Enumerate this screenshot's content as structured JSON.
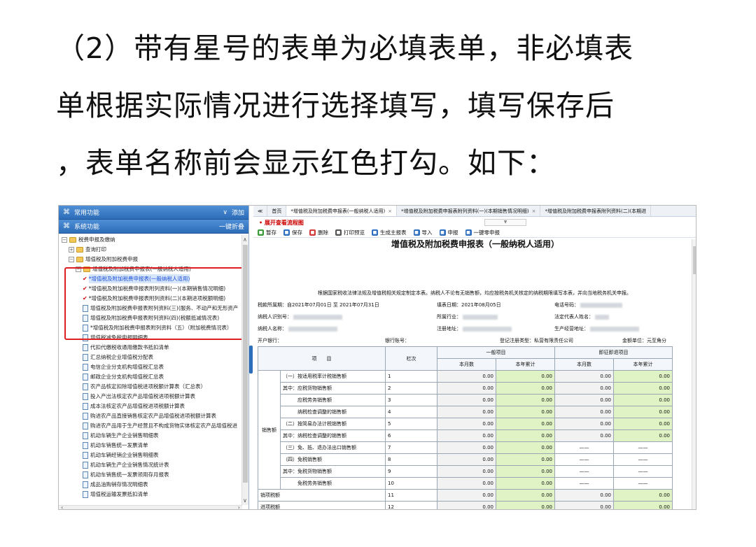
{
  "caption_lines": [
    "（2）带有星号的表单为必填表单，非必填表",
    "单根据实际情况进行选择填写，填写保存后",
    "，表单名称前会显示红色打勾。如下："
  ],
  "left": {
    "header1": {
      "icon": "grid-icon",
      "title": "常用功能",
      "chev": "∨",
      "action": "添加"
    },
    "header2": {
      "icon": "grid-icon",
      "title": "系统功能",
      "action": "一键折叠"
    },
    "tree": [
      {
        "text": "税费申报及缴纳",
        "toggle": "−",
        "folder": true,
        "indent": 0
      },
      {
        "text": "查询打印",
        "toggle": "+",
        "folder": true,
        "indent": 1
      },
      {
        "text": "增值税及附加税费申报",
        "toggle": "−",
        "folder": true,
        "indent": 1
      },
      {
        "text": "增值税及附加税费申报表(一般纳税人适用)",
        "toggle": "−",
        "folder": true,
        "indent": 2
      },
      {
        "text": "*增值税及附加税费申报表(一般纳税人适用)",
        "check": "✔",
        "indent": 3,
        "selected": true
      },
      {
        "text": "*增值税及附加税费申报表附列资料(一)(本期销售情况明细)",
        "check": "✔",
        "indent": 3
      },
      {
        "text": "*增值税及附加税费申报表附列资料(二)(本期进项税额明细)",
        "check": "✔",
        "indent": 3
      },
      {
        "text": "增值税及附加税费申报表附列资料(三)(服务、不动产和无形资产",
        "file": true,
        "indent": 3
      },
      {
        "text": "增值税及附加税费申报表附列资料(四)(税额抵减情况表)",
        "file": true,
        "indent": 3
      },
      {
        "text": "*增值税及附加税费申报表附列资料（五）（附加税费情况表）",
        "file": true,
        "indent": 3
      },
      {
        "text": "增值税减免税申报明细表",
        "file": true,
        "indent": 3
      },
      {
        "text": "代扣代缴税收通用缴款书抵扣清单",
        "file": true,
        "indent": 3
      },
      {
        "text": "汇总纳税企业增值税分配表",
        "file": true,
        "indent": 3
      },
      {
        "text": "电信企业分支机构增值税汇总表",
        "file": true,
        "indent": 3
      },
      {
        "text": "邮政企业分支机构增值税汇总表",
        "file": true,
        "indent": 3
      },
      {
        "text": "农产品核定扣除增值税进项税额计算表（汇总表）",
        "file": true,
        "indent": 3
      },
      {
        "text": "投入产出法核定农产品增值税进项税额计算表",
        "file": true,
        "indent": 3
      },
      {
        "text": "成本法核定农产品增值税进项税额计算表",
        "file": true,
        "indent": 3
      },
      {
        "text": "购进农产品直接销售核定农产品增值税进项税额计算表",
        "file": true,
        "indent": 3
      },
      {
        "text": "购进农产品用于生产经营且不构成货物实体核定农产品增值税进",
        "file": true,
        "indent": 3
      },
      {
        "text": "机动车辆生产企业销售明细表",
        "file": true,
        "indent": 3
      },
      {
        "text": "机动车销售统一发票清单",
        "file": true,
        "indent": 3
      },
      {
        "text": "机动车辆经销企业销售明细表",
        "file": true,
        "indent": 3
      },
      {
        "text": "机动车辆生产企业销售情况统计表",
        "file": true,
        "indent": 3
      },
      {
        "text": "机动车销售统一发票领用存月报表",
        "file": true,
        "indent": 3
      },
      {
        "text": "成品油购销存情况明细表",
        "file": true,
        "indent": 3
      },
      {
        "text": "增值税运输发票抵扣清单",
        "file": true,
        "indent": 3
      }
    ]
  },
  "right": {
    "tabs": [
      {
        "label": "≪",
        "close": false
      },
      {
        "label": "首页",
        "close": false
      },
      {
        "label": "*增值税及附加税费申报表(一般纳税人适用)",
        "close": true,
        "active": true
      },
      {
        "label": "*增值税及附加税费申报表附列资料(一)(本期销售情况明细)",
        "close": true
      },
      {
        "label": "*增值税及附加税费申报表附列资料(二)(本期进",
        "close": false
      }
    ],
    "flow_link": "• 展开查看流程图",
    "dropdown": "▼",
    "toolbar": [
      {
        "label": "暂存",
        "color": "#3a9a3a",
        "icon": "save-draft-icon"
      },
      {
        "label": "保存",
        "color": "#2f6fbf",
        "icon": "save-icon"
      },
      {
        "label": "删除",
        "color": "#d23a3a",
        "icon": "delete-icon"
      },
      {
        "label": "打印预览",
        "color": "#555555",
        "icon": "print-icon"
      },
      {
        "label": "生成主报表",
        "color": "#2f6fbf",
        "icon": "generate-icon"
      },
      {
        "label": "导入",
        "color": "#2f6fbf",
        "icon": "import-icon"
      },
      {
        "label": "申报",
        "color": "#2f6fbf",
        "icon": "submit-icon"
      },
      {
        "label": "一键零申报",
        "color": "#2f6fbf",
        "icon": "zero-report-icon"
      }
    ],
    "form_title": "增值税及附加税费申报表（一般纳税人适用）",
    "basis": "根据国家税收法律法规及增值税相关规定制定本表。纳税人不论有无销售额，均应按税务机关核定的纳税期限填写本表，并向当地税务机关申报。",
    "info": {
      "period_label": "税款所属期：",
      "period_value": "自2021年07月01日 至 2021年07月31日",
      "fill_date": "填表日期：2021年08月05日",
      "phone_label": "电话号码：",
      "taxid_label": "纳税人识别号：",
      "industry_label": "所属行业：",
      "legal_label": "法定代表人姓名：",
      "name_label": "纳税人名称：",
      "reg_addr_label": "注册地址：",
      "prod_addr_label": "生产经营地址：",
      "bank_label": "开户银行：",
      "account_label": "银行账号：",
      "reg_type": "登记注册类型：私营有限责任公司",
      "unit": "金额单位：元至角分"
    },
    "table": {
      "h_item": "项　　目",
      "h_col": "栏次",
      "h_general": "一般项目",
      "h_immediate": "即征即退项目",
      "h_month": "本月数",
      "h_year": "本年累计",
      "sales_group": "销售额",
      "rows": [
        {
          "label": "（一）按适用税率计税销售额",
          "no": "1",
          "v": [
            "0.00",
            "0.00",
            "0.00",
            "0.00"
          ]
        },
        {
          "label": "其中：应税货物销售额",
          "no": "2",
          "v": [
            "0.00",
            "0.00",
            "0.00",
            "0.00"
          ]
        },
        {
          "label": "　　　应税劳务销售额",
          "no": "3",
          "v": [
            "0.00",
            "0.00",
            "0.00",
            "0.00"
          ]
        },
        {
          "label": "　　　纳税检查调整的销售额",
          "no": "4",
          "v": [
            "0.00",
            "0.00",
            "0.00",
            "0.00"
          ]
        },
        {
          "label": "（二）按简易办法计税销售额",
          "no": "5",
          "v": [
            "0.00",
            "0.00",
            "0.00",
            "0.00"
          ]
        },
        {
          "label": "其中：纳税检查调整的销售额",
          "no": "6",
          "v": [
            "0.00",
            "0.00",
            "0.00",
            "0.00"
          ]
        },
        {
          "label": "（三）免、抵、退办法出口销售额",
          "no": "7",
          "v": [
            "0.00",
            "0.00",
            "——",
            "——"
          ]
        },
        {
          "label": "（四）免税销售额",
          "no": "8",
          "v": [
            "0.00",
            "0.00",
            "——",
            "——"
          ]
        },
        {
          "label": "其中：免税货物销售额",
          "no": "9",
          "v": [
            "0.00",
            "0.00",
            "——",
            "——"
          ]
        },
        {
          "label": "　　　免税劳务销售额",
          "no": "10",
          "v": [
            "0.00",
            "0.00",
            "——",
            "——"
          ]
        },
        {
          "label": "销项税额",
          "no": "11",
          "v": [
            "0.00",
            "0.00",
            "0.00",
            "0.00"
          ]
        },
        {
          "label": "进项税额",
          "no": "12",
          "v": [
            "0.00",
            "0.00",
            "0.00",
            "0.00"
          ]
        }
      ]
    }
  }
}
